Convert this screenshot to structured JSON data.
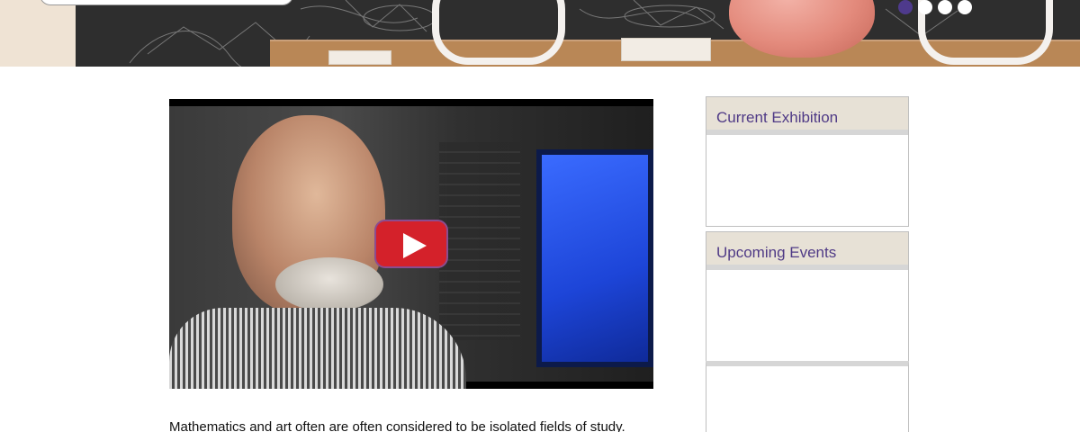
{
  "slideshow": {
    "dots": [
      {
        "active": true
      },
      {
        "active": false
      },
      {
        "active": false
      },
      {
        "active": false
      }
    ]
  },
  "video": {
    "play_icon": "play-icon"
  },
  "main": {
    "intro_text": "Mathematics and art often are often considered to be isolated fields of study."
  },
  "sidebar": {
    "current_exhibition_title": "Current Exhibition",
    "upcoming_events_title": "Upcoming Events"
  },
  "colors": {
    "accent": "#4e3a8c",
    "widget_header_bg": "#e7e1d6",
    "play_red": "#d4212a"
  }
}
